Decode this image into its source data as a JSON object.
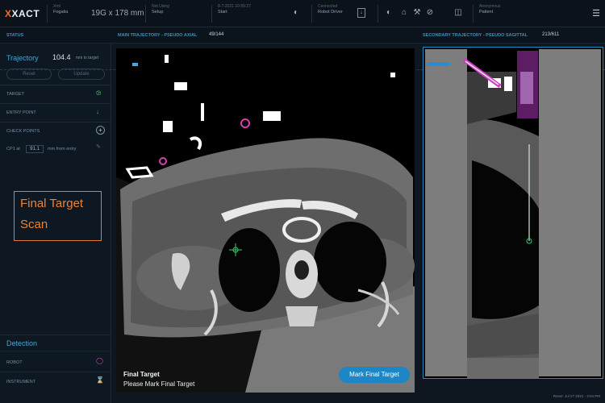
{
  "header": {
    "logo": "XACT",
    "cells": [
      {
        "label": "Xmt",
        "value": "Fogatia"
      },
      {
        "label": "Not Using",
        "value": "Setup"
      },
      {
        "label": "8-7-2021 10:55:27",
        "value": "Start"
      },
      {
        "label": "Connected",
        "value": "Robot Driver"
      },
      {
        "label": "Anonymous",
        "value": "Patient"
      }
    ],
    "needle": "19G x 178 mm"
  },
  "views_bar": {
    "main_label": "MAIN TRAJECTORY - PSEUDO AXIAL",
    "main_count": "49/144",
    "secondary_label": "SECONDARY TRAJECTORY - PSEUDO SAGITTAL",
    "secondary_count": "213/611",
    "status": "STATUS"
  },
  "left_panel": {
    "trajectory_label": "Trajectory",
    "trajectory_value": "104.4",
    "trajectory_unit": "mm to target",
    "buttons": [
      "Reset",
      "Update"
    ],
    "rows": [
      {
        "label": "TARGET",
        "icon": "target-icon",
        "color": "#36c96b"
      },
      {
        "label": "ENTRY POINT",
        "icon": "arrow-down-icon",
        "color": "#36c96b"
      },
      {
        "label": "CHECK POINTS",
        "icon": "plus-circle-icon",
        "color": "#9aa9b8"
      }
    ],
    "checkpoint_prefix": "CP1 at",
    "checkpoint_value": "91.1",
    "checkpoint_suffix": "mm from entry",
    "annotation": [
      "Final Target",
      "Scan"
    ],
    "detection_label": "Detection",
    "detection_rows": [
      {
        "label": "ROBOT",
        "icon": "robot-icon",
        "color": "#e04ab8"
      },
      {
        "label": "INSTRUMENT",
        "icon": "instrument-icon",
        "color": "#e04ab8"
      }
    ]
  },
  "main_view": {
    "title": "Final Target",
    "subtitle": "Please Mark Final Target",
    "button": "Mark Final Target"
  },
  "footer": {
    "status": "Reset: Jul 27 2021 - 3:04 PM"
  },
  "colors": {
    "accent": "#1c86c6",
    "annotation": "#f0822f",
    "robot": "#e04ab8"
  }
}
